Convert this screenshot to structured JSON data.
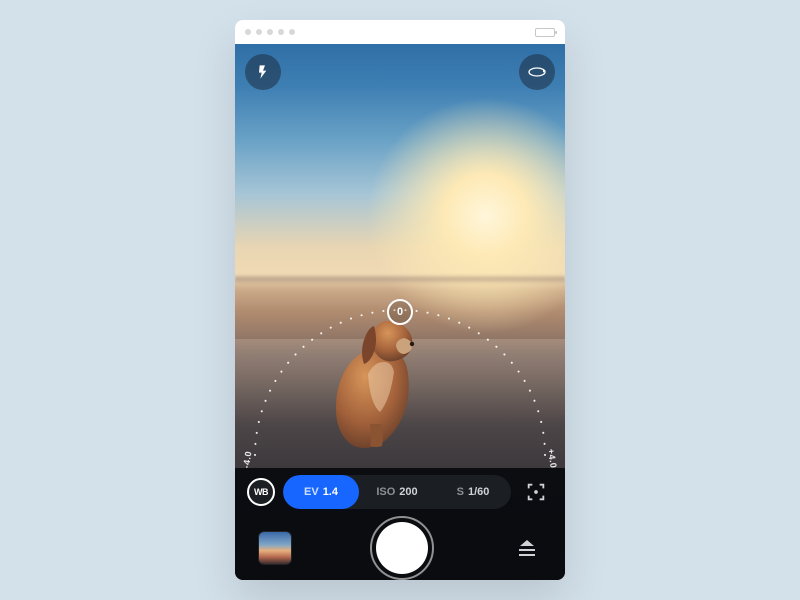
{
  "dial": {
    "min_label": "-4.0",
    "max_label": "+4.0",
    "current": "0"
  },
  "settings": {
    "wb_label": "WB",
    "ev": {
      "key": "EV",
      "value": "1.4"
    },
    "iso": {
      "key": "ISO",
      "value": "200"
    },
    "s": {
      "key": "S",
      "value": "1/60"
    }
  },
  "colors": {
    "accent": "#1766ff"
  },
  "icons": {
    "flash": "flash-icon",
    "flip": "flip-camera-icon",
    "focus": "focus-frame-icon",
    "stack": "eject-icon"
  }
}
